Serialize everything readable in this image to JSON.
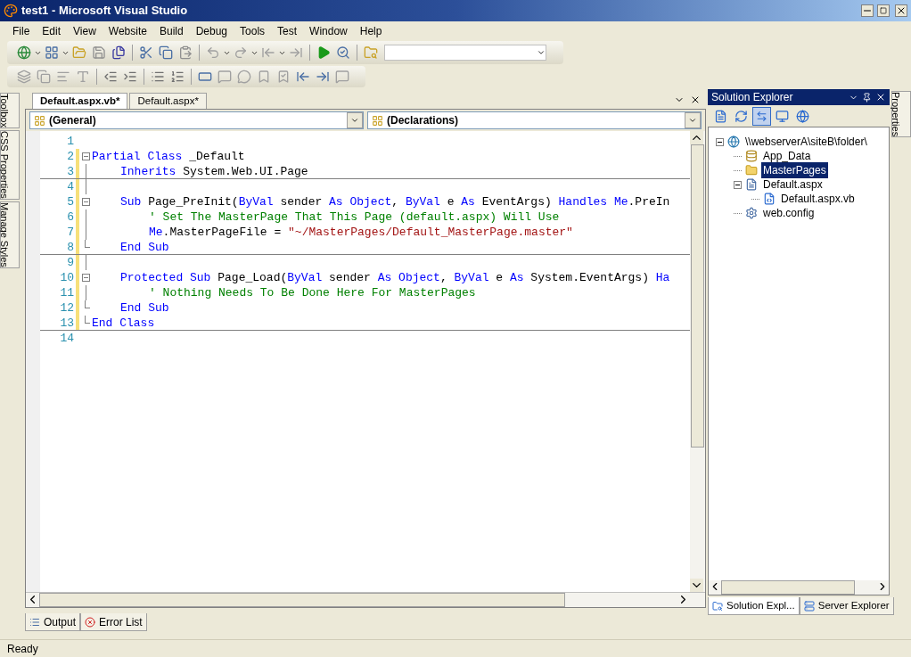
{
  "window": {
    "title": "test1 - Microsoft Visual Studio"
  },
  "menu": [
    "File",
    "Edit",
    "View",
    "Website",
    "Build",
    "Debug",
    "Tools",
    "Test",
    "Window",
    "Help"
  ],
  "left_tool_tabs": [
    "Toolbox",
    "CSS Properties",
    "Manage Styles"
  ],
  "right_tool_tabs": [
    "Properties"
  ],
  "editor": {
    "tabs": [
      {
        "label": "Default.aspx.vb*",
        "selected": true
      },
      {
        "label": "Default.aspx*",
        "selected": false
      }
    ],
    "class_dropdown": "(General)",
    "member_dropdown": "(Declarations)",
    "lines": [
      {
        "number": "1",
        "collapsible": false,
        "block_end": false,
        "separator": false
      },
      {
        "number": "2",
        "collapsible": true,
        "block_end": false,
        "separator": false,
        "tokens": [
          {
            "kind": "keyword",
            "text": "Partial Class"
          },
          {
            "kind": "plain",
            "text": " _Default"
          }
        ],
        "children": [
          {
            "number": "3",
            "collapsible": false,
            "block_end": false,
            "separator": true,
            "tokens": [
              {
                "kind": "keyword",
                "text": "Inherits"
              },
              {
                "kind": "plain",
                "text": " System.Web.UI.Page"
              }
            ]
          },
          {
            "number": "4",
            "collapsible": false,
            "block_end": false,
            "separator": false
          },
          {
            "number": "5",
            "collapsible": true,
            "block_end": false,
            "separator": false,
            "tokens": [
              {
                "kind": "keyword",
                "text": "Sub"
              },
              {
                "kind": "plain",
                "text": " Page_PreInit("
              },
              {
                "kind": "keyword",
                "text": "ByVal"
              },
              {
                "kind": "plain",
                "text": " sender "
              },
              {
                "kind": "keyword",
                "text": "As Object"
              },
              {
                "kind": "plain",
                "text": ", "
              },
              {
                "kind": "keyword",
                "text": "ByVal"
              },
              {
                "kind": "plain",
                "text": " e "
              },
              {
                "kind": "keyword",
                "text": "As"
              },
              {
                "kind": "plain",
                "text": " EventArgs) "
              },
              {
                "kind": "keyword",
                "text": "Handles Me"
              },
              {
                "kind": "plain",
                "text": ".PreIn"
              }
            ],
            "children": [
              {
                "number": "6",
                "collapsible": false,
                "block_end": false,
                "separator": false,
                "tokens": [
                  {
                    "kind": "comment",
                    "text": "' Set The MasterPage That This Page (default.aspx) Will Use"
                  }
                ]
              },
              {
                "number": "7",
                "collapsible": false,
                "block_end": false,
                "separator": false,
                "tokens": [
                  {
                    "kind": "keyword",
                    "text": "Me"
                  },
                  {
                    "kind": "plain",
                    "text": ".MasterPageFile = "
                  },
                  {
                    "kind": "string",
                    "text": "\"~/MasterPages/Default_MasterPage.master\""
                  }
                ]
              }
            ]
          },
          {
            "number": "8",
            "collapsible": false,
            "block_end": true,
            "separator": true,
            "tokens": [
              {
                "kind": "keyword",
                "text": "End Sub"
              }
            ]
          },
          {
            "number": "9",
            "collapsible": false,
            "block_end": false,
            "separator": false
          },
          {
            "number": "10",
            "collapsible": true,
            "block_end": false,
            "separator": false,
            "tokens": [
              {
                "kind": "keyword",
                "text": "Protected Sub"
              },
              {
                "kind": "plain",
                "text": " Page_Load("
              },
              {
                "kind": "keyword",
                "text": "ByVal"
              },
              {
                "kind": "plain",
                "text": " sender "
              },
              {
                "kind": "keyword",
                "text": "As Object"
              },
              {
                "kind": "plain",
                "text": ", "
              },
              {
                "kind": "keyword",
                "text": "ByVal"
              },
              {
                "kind": "plain",
                "text": " e "
              },
              {
                "kind": "keyword",
                "text": "As"
              },
              {
                "kind": "plain",
                "text": " System.EventArgs) "
              },
              {
                "kind": "keyword",
                "text": "Ha"
              }
            ],
            "children": [
              {
                "number": "11",
                "collapsible": false,
                "block_end": false,
                "separator": false,
                "tokens": [
                  {
                    "kind": "comment",
                    "text": "' Nothing Needs To Be Done Here For MasterPages"
                  }
                ]
              }
            ]
          },
          {
            "number": "12",
            "collapsible": false,
            "block_end": true,
            "separator": false,
            "tokens": [
              {
                "kind": "keyword",
                "text": "End Sub"
              }
            ]
          }
        ]
      },
      {
        "number": "13",
        "collapsible": false,
        "block_end": true,
        "separator": true,
        "tokens": [
          {
            "kind": "keyword",
            "text": "End Class"
          }
        ]
      },
      {
        "number": "14",
        "collapsible": false,
        "block_end": false,
        "separator": false
      }
    ]
  },
  "solution_explorer": {
    "title": "Solution Explorer",
    "toolbar_buttons": [
      {
        "pressed": false
      },
      {
        "pressed": false
      },
      {
        "pressed": true
      },
      {
        "pressed": false
      },
      {
        "pressed": false
      }
    ],
    "tree": [
      {
        "label": "\\\\webserverA\\siteB\\folder\\",
        "kind": "site",
        "selected": false,
        "expanded": true,
        "children": [
          {
            "label": "App_Data",
            "kind": "datafolder",
            "selected": false
          },
          {
            "label": "MasterPages",
            "kind": "folder",
            "selected": true
          },
          {
            "label": "Default.aspx",
            "kind": "page",
            "selected": false,
            "expanded": true,
            "children": [
              {
                "label": "Default.aspx.vb",
                "kind": "code",
                "selected": false
              }
            ]
          },
          {
            "label": "web.config",
            "kind": "config",
            "selected": false
          }
        ]
      }
    ],
    "tabs": [
      {
        "label": "Solution Expl...",
        "selected": true
      },
      {
        "label": "Server Explorer",
        "selected": false
      }
    ]
  },
  "bottom_tabs": [
    {
      "label": "Output",
      "kind": "output"
    },
    {
      "label": "Error List",
      "kind": "errors"
    }
  ],
  "status_bar": {
    "text": "Ready"
  }
}
